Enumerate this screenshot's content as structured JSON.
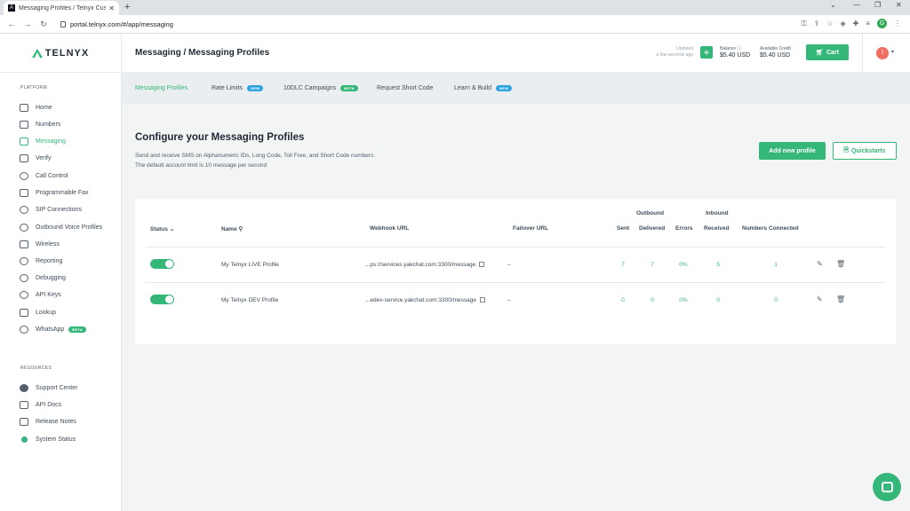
{
  "browser": {
    "tab_title": "Messaging Profiles / Telnyx Custo",
    "url": "portal.telnyx.com/#/app/messaging"
  },
  "header": {
    "logo_text": "TELNYX",
    "breadcrumb": "Messaging / Messaging Profiles",
    "updated_label": "Updated",
    "updated_value": "a few seconds ago",
    "balance_label": "Balance",
    "balance_value": "$5.40 USD",
    "credit_label": "Available Credit",
    "credit_value": "$5.40 USD",
    "cart_label": "Cart",
    "avatar_initial": "I"
  },
  "sidebar": {
    "platform_title": "PLATFORM",
    "items": [
      {
        "label": "Home"
      },
      {
        "label": "Numbers"
      },
      {
        "label": "Messaging"
      },
      {
        "label": "Verify"
      },
      {
        "label": "Call Control"
      },
      {
        "label": "Programmable Fax"
      },
      {
        "label": "SIP Connections"
      },
      {
        "label": "Outbound Voice Profiles"
      },
      {
        "label": "Wireless"
      },
      {
        "label": "Reporting"
      },
      {
        "label": "Debugging"
      },
      {
        "label": "API Keys"
      },
      {
        "label": "Lookup"
      },
      {
        "label": "WhatsApp",
        "badge": "BETA"
      }
    ],
    "resources_title": "RESOURCES",
    "resources": [
      {
        "label": "Support Center"
      },
      {
        "label": "API Docs"
      },
      {
        "label": "Release Notes"
      },
      {
        "label": "System Status"
      }
    ]
  },
  "subnav": {
    "tabs": [
      {
        "label": "Messaging Profiles"
      },
      {
        "label": "Rate Limits",
        "badge": "NEW"
      },
      {
        "label": "10DLC Campaigns",
        "badge": "BETA"
      },
      {
        "label": "Request Short Code"
      },
      {
        "label": "Learn & Build",
        "badge": "NEW"
      }
    ]
  },
  "main": {
    "title": "Configure your Messaging Profiles",
    "desc_line1": "Send and receive SMS on Alphanumeric IDs, Long Code, Toll Free, and Short Code numbers.",
    "desc_line2": "The default account limit is 10 message per second",
    "add_label": "Add new profile",
    "quickstarts_label": "Quickstarts"
  },
  "table": {
    "group_outbound": "Outbound",
    "group_inbound": "Inbound",
    "col_status": "Status",
    "col_name": "Name",
    "col_webhook": "Webhook URL",
    "col_failover": "Failover URL",
    "col_sent": "Sent",
    "col_delivered": "Delivered",
    "col_errors": "Errors",
    "col_received": "Received",
    "col_numbers": "Numbers Connected",
    "rows": [
      {
        "name": "My Telnyx LIVE Profile",
        "webhook": "...ps://services.yakchat.com:3300/message",
        "failover": "–",
        "sent": "7",
        "delivered": "7",
        "errors": "0%",
        "received": "5",
        "numbers": "1"
      },
      {
        "name": "My Telnyx DEV Profile",
        "webhook": "...edev-service.yakchat.com:3300/message",
        "failover": "–",
        "sent": "0",
        "delivered": "0",
        "errors": "0%",
        "received": "0",
        "numbers": "0"
      }
    ]
  },
  "colors": {
    "accent": "#35b77a",
    "badge_new": "#2da3e0"
  }
}
